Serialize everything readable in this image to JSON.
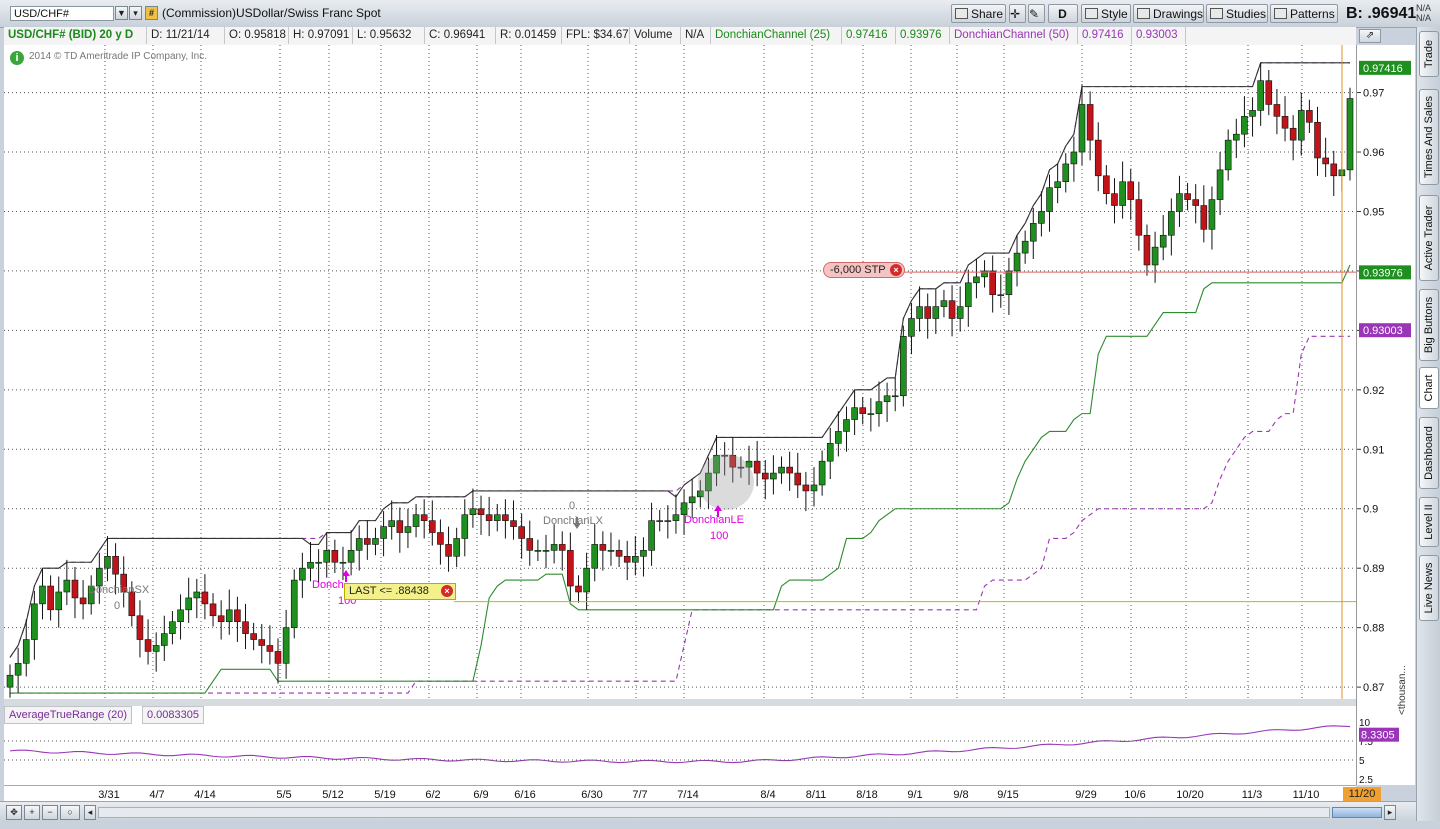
{
  "toolbar": {
    "symbol": "USD/CHF#",
    "description": "(Commission)USDollar/Swiss Franc Spot",
    "buttons": [
      "Share",
      "D",
      "Style",
      "Drawings",
      "Studies",
      "Patterns"
    ],
    "bid_label": "B: .96941",
    "na_top": "N/A",
    "na_bottom": "N/A"
  },
  "info": {
    "symbol": "USD/CHF# (BID) 20 y D",
    "date": "D: 11/21/14",
    "open": "O: 0.95818",
    "high": "H: 0.97091",
    "low": "L: 0.95632",
    "close": "C: 0.96941",
    "range": "R: 0.01459",
    "fpl": "FPL: $34.67",
    "volume": "Volume",
    "volume_value": "N/A",
    "dc25_label": "DonchianChannel (25)",
    "dc25_upper": "0.97416",
    "dc25_lower": "0.93976",
    "dc50_label": "DonchianChannel (50)",
    "dc50_upper": "0.97416",
    "dc50_lower": "0.93003"
  },
  "copyright": "2014 © TD Ameritrade IP Company, Inc.",
  "atr": {
    "label": "AverageTrueRange (20)",
    "value": "0.0083305",
    "badge": "8.3305",
    "unit": "<thousan...",
    "ticks": [
      "10",
      "7.5",
      "5",
      "2.5"
    ]
  },
  "sidebar_tabs": [
    "Trade",
    "Times And Sales",
    "Active Trader",
    "Big Buttons",
    "Chart",
    "Dashboard",
    "Level II",
    "Live News"
  ],
  "colors": {
    "up": "#1f8f1f",
    "down": "#c0141a",
    "dc25": "#2e8b2e",
    "dc50": "#9a35b8",
    "upperline": "#333333",
    "stop": "#e06060",
    "limit": "#c8b400",
    "signal": "#e000e0"
  },
  "chart_data": {
    "type": "candlestick",
    "instrument": "USD/CHF#",
    "ylim": [
      0.868,
      0.978
    ],
    "y_ticks": [
      "0.87",
      "0.88",
      "0.89",
      "0.9",
      "0.91",
      "0.92",
      "0.93",
      "0.94",
      "0.95",
      "0.96",
      "0.97"
    ],
    "x_ticks": [
      "3/31",
      "4/7",
      "4/14",
      "5/5",
      "5/12",
      "5/19",
      "6/2",
      "6/9",
      "6/16",
      "6/30",
      "7/7",
      "7/14",
      "8/4",
      "8/11",
      "8/18",
      "9/1",
      "9/8",
      "9/15",
      "9/29",
      "10/6",
      "10/20",
      "11/3",
      "11/10"
    ],
    "last_date_label": "11/20",
    "price_badges": [
      "0.97416",
      "0.93976",
      "0.93003"
    ],
    "stop_order": {
      "label": "-6,000 STP",
      "price": 0.9398
    },
    "limit_order": {
      "label": "LAST <= .88438",
      "price": 0.88438
    },
    "signals": [
      {
        "label": "DonchianLE",
        "qty": "100",
        "price": 0.9025
      },
      {
        "label": "DonchianLX",
        "qty": "0",
        "price": 0.8935
      },
      {
        "label": "DonchianSX",
        "qty": "0",
        "price": 0.885
      },
      {
        "label": "Donch...",
        "qty": "100",
        "price": 0.889
      }
    ],
    "candles_close": [
      0.872,
      0.874,
      0.878,
      0.884,
      0.887,
      0.883,
      0.886,
      0.888,
      0.885,
      0.884,
      0.887,
      0.89,
      0.892,
      0.889,
      0.886,
      0.882,
      0.878,
      0.876,
      0.877,
      0.879,
      0.881,
      0.883,
      0.885,
      0.886,
      0.884,
      0.882,
      0.881,
      0.883,
      0.881,
      0.879,
      0.878,
      0.877,
      0.876,
      0.874,
      0.88,
      0.888,
      0.89,
      0.891,
      0.891,
      0.893,
      0.891,
      0.891,
      0.893,
      0.895,
      0.894,
      0.895,
      0.897,
      0.898,
      0.896,
      0.897,
      0.899,
      0.898,
      0.896,
      0.894,
      0.892,
      0.895,
      0.899,
      0.9,
      0.899,
      0.898,
      0.899,
      0.898,
      0.897,
      0.895,
      0.893,
      0.893,
      0.893,
      0.894,
      0.893,
      0.887,
      0.886,
      0.89,
      0.894,
      0.893,
      0.893,
      0.892,
      0.891,
      0.892,
      0.893,
      0.898,
      0.898,
      0.898,
      0.899,
      0.901,
      0.902,
      0.903,
      0.906,
      0.909,
      0.909,
      0.907,
      0.907,
      0.908,
      0.906,
      0.905,
      0.906,
      0.907,
      0.906,
      0.904,
      0.903,
      0.904,
      0.908,
      0.911,
      0.913,
      0.915,
      0.917,
      0.916,
      0.916,
      0.918,
      0.919,
      0.919,
      0.929,
      0.932,
      0.934,
      0.932,
      0.934,
      0.935,
      0.932,
      0.934,
      0.938,
      0.939,
      0.94,
      0.936,
      0.936,
      0.94,
      0.943,
      0.945,
      0.948,
      0.95,
      0.954,
      0.955,
      0.958,
      0.96,
      0.968,
      0.962,
      0.956,
      0.953,
      0.951,
      0.955,
      0.952,
      0.946,
      0.941,
      0.944,
      0.946,
      0.95,
      0.953,
      0.952,
      0.951,
      0.947,
      0.952,
      0.957,
      0.962,
      0.963,
      0.966,
      0.967,
      0.972,
      0.968,
      0.966,
      0.964,
      0.962,
      0.967,
      0.965,
      0.959,
      0.958,
      0.956,
      0.957,
      0.969
    ],
    "donchian25": {
      "upper_last": 0.97416,
      "lower_last": 0.93976
    },
    "donchian50": {
      "upper_last": 0.97416,
      "lower_last": 0.93003
    },
    "atr_series_last": 8.3305,
    "atr_ylim": [
      2.5,
      10
    ]
  }
}
